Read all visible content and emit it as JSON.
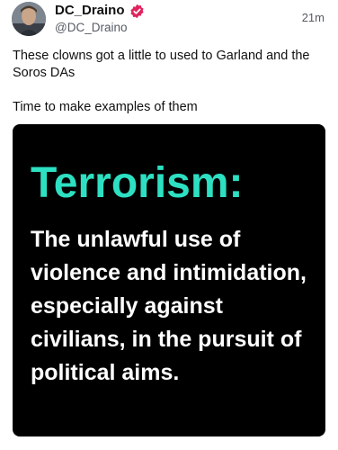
{
  "author": {
    "display_name": "DC_Draino",
    "handle": "@DC_Draino",
    "verified": true,
    "verified_icon": "verified-badge-icon",
    "verified_color": "#e0245e"
  },
  "timestamp": "21m",
  "post": {
    "line1": "These clowns got a little to used to Garland and the Soros DAs",
    "line2": "Time to make examples of them"
  },
  "media": {
    "title": "Terrorism:",
    "body": "The unlawful use of violence and intimidation, especially against civilians, in the pursuit of political aims.",
    "title_color": "#2de0c2",
    "body_color": "#ffffff",
    "background": "#000000"
  }
}
